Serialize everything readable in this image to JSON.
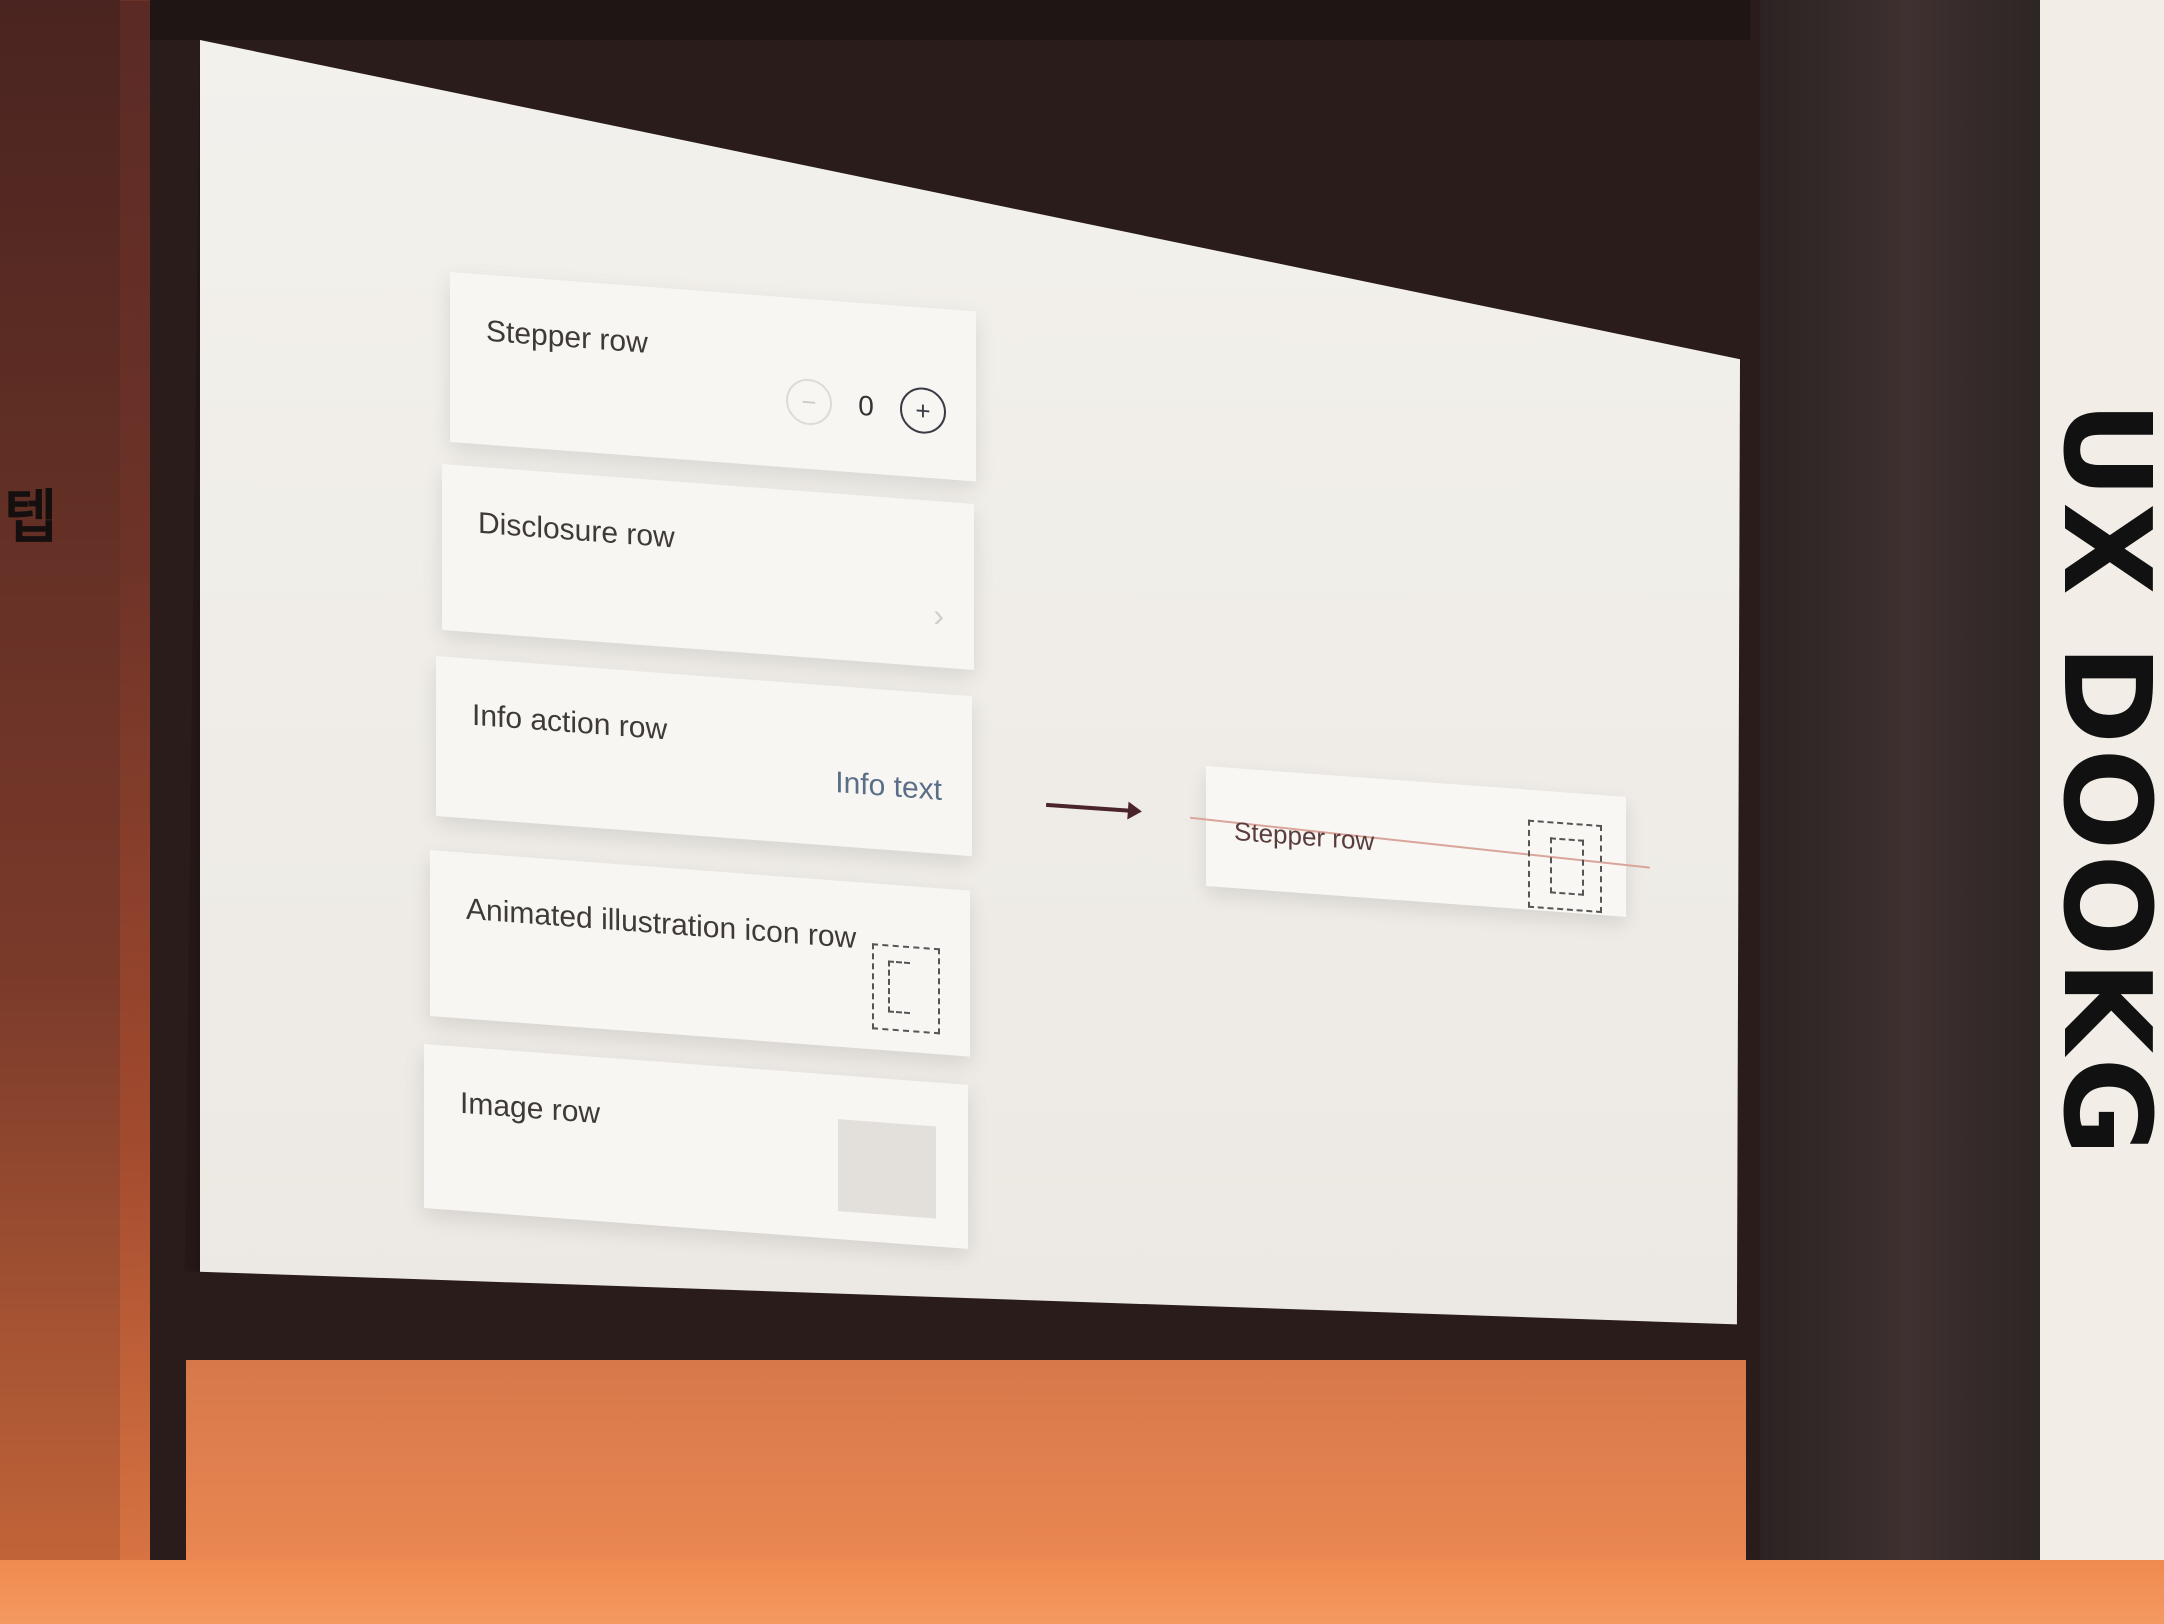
{
  "wall_text_left": "텝",
  "banner_text": "UX DOOKG",
  "rows": [
    {
      "label": "Stepper row",
      "stepper_minus": "−",
      "stepper_value": "0",
      "stepper_plus": "+"
    },
    {
      "label": "Disclosure row",
      "chevron": "›"
    },
    {
      "label": "Info action row",
      "info_text": "Info text"
    },
    {
      "label": "Animated illustration icon row"
    },
    {
      "label": "Image row"
    }
  ],
  "target_row": {
    "label": "Stepper row"
  }
}
